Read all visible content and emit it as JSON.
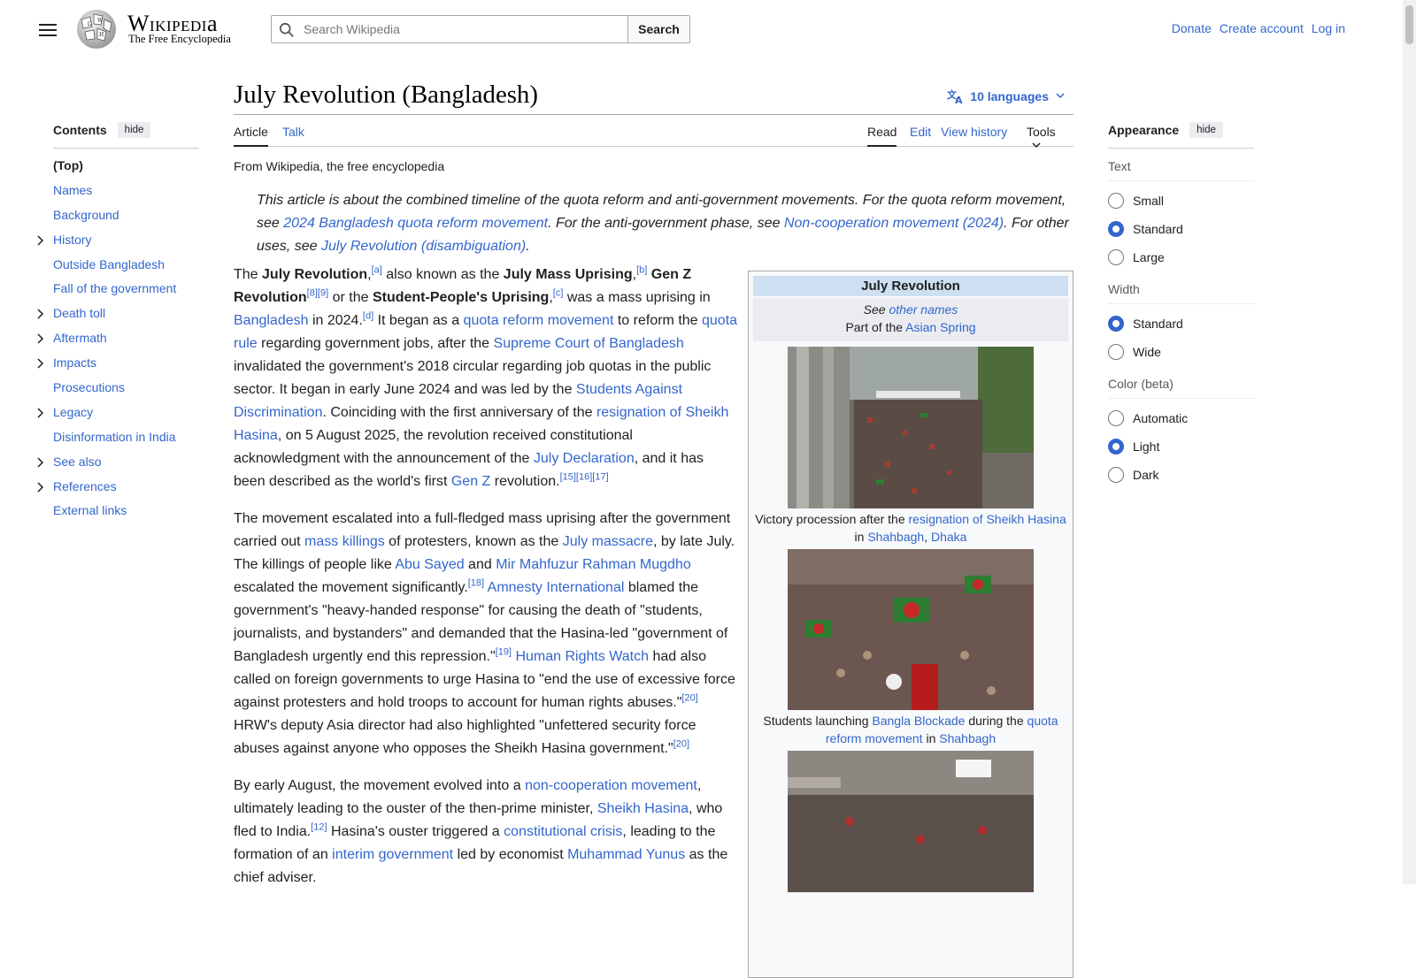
{
  "header": {
    "wordmark": "Wikipedia",
    "tagline": "The Free Encyclopedia",
    "search_placeholder": "Search Wikipedia",
    "search_button": "Search",
    "links": [
      "Donate",
      "Create account",
      "Log in"
    ]
  },
  "toc": {
    "title": "Contents",
    "hide_label": "hide",
    "items": [
      {
        "label": "(Top)",
        "expandable": false
      },
      {
        "label": "Names",
        "expandable": false
      },
      {
        "label": "Background",
        "expandable": false
      },
      {
        "label": "History",
        "expandable": true
      },
      {
        "label": "Outside Bangladesh",
        "expandable": false
      },
      {
        "label": "Fall of the government",
        "expandable": false
      },
      {
        "label": "Death toll",
        "expandable": true
      },
      {
        "label": "Aftermath",
        "expandable": true
      },
      {
        "label": "Impacts",
        "expandable": true
      },
      {
        "label": "Prosecutions",
        "expandable": false
      },
      {
        "label": "Legacy",
        "expandable": true
      },
      {
        "label": "Disinformation in India",
        "expandable": false
      },
      {
        "label": "See also",
        "expandable": true
      },
      {
        "label": "References",
        "expandable": true
      },
      {
        "label": "External links",
        "expandable": false
      }
    ]
  },
  "article": {
    "title": "July Revolution (Bangladesh)",
    "languages": "10 languages",
    "tabs": {
      "article": "Article",
      "talk": "Talk",
      "read": "Read",
      "edit": "Edit",
      "history": "View history",
      "tools": "Tools"
    },
    "from": "From Wikipedia, the free encyclopedia",
    "hatnote": [
      {
        "t": "This article is about the combined timeline of the quota reform and anti-government movements. For the quota reform movement, see "
      },
      {
        "t": "2024 Bangladesh quota reform movement",
        "link": true
      },
      {
        "t": ". For the anti-government phase, see "
      },
      {
        "t": "Non-cooperation movement (2024)",
        "link": true
      },
      {
        "t": ". For other uses, see "
      },
      {
        "t": "July Revolution (disambiguation)",
        "link": true
      },
      {
        "t": "."
      }
    ],
    "paragraphs": [
      [
        {
          "t": "The "
        },
        {
          "t": "July Revolution",
          "b": true
        },
        {
          "t": ",",
          "b": false
        },
        {
          "t": "[a]",
          "sup": true
        },
        {
          "t": " also known as the "
        },
        {
          "t": "July Mass Uprising",
          "b": true
        },
        {
          "t": ","
        },
        {
          "t": "[b]",
          "sup": true
        },
        {
          "t": " "
        },
        {
          "t": "Gen Z Revolution",
          "b": true
        },
        {
          "t": "[8][9]",
          "sup": true
        },
        {
          "t": " or the "
        },
        {
          "t": "Student-People's Uprising",
          "b": true
        },
        {
          "t": ","
        },
        {
          "t": "[c]",
          "sup": true
        },
        {
          "t": " was a mass uprising in "
        },
        {
          "t": "Bangladesh",
          "link": true
        },
        {
          "t": " in 2024."
        },
        {
          "t": "[d]",
          "sup": true
        },
        {
          "t": " It began as a "
        },
        {
          "t": "quota reform movement",
          "link": true
        },
        {
          "t": " to reform the "
        },
        {
          "t": "quota rule",
          "link": true
        },
        {
          "t": " regarding government jobs, after the "
        },
        {
          "t": "Supreme Court of Bangladesh",
          "link": true
        },
        {
          "t": " invalidated the government's 2018 circular regarding job quotas in the public sector. It began in early June 2024 and was led by the "
        },
        {
          "t": "Students Against Discrimination",
          "link": true
        },
        {
          "t": ". Coinciding with the first anniversary of the "
        },
        {
          "t": "resignation of Sheikh Hasina",
          "link": true
        },
        {
          "t": ", on 5 August 2025, the revolution received constitutional acknowledgment with the announcement of the "
        },
        {
          "t": "July Declaration",
          "link": true
        },
        {
          "t": ", and it has been described as the world's first "
        },
        {
          "t": "Gen Z",
          "link": true
        },
        {
          "t": " revolution."
        },
        {
          "t": "[15][16][17]",
          "sup": true
        }
      ],
      [
        {
          "t": "The movement escalated into a full-fledged mass uprising after the government carried out "
        },
        {
          "t": "mass killings",
          "link": true
        },
        {
          "t": " of protesters, known as the "
        },
        {
          "t": "July massacre",
          "link": true
        },
        {
          "t": ", by late July. The killings of people like "
        },
        {
          "t": "Abu Sayed",
          "link": true
        },
        {
          "t": " and "
        },
        {
          "t": "Mir Mahfuzur Rahman Mugdho",
          "link": true
        },
        {
          "t": " escalated the movement significantly."
        },
        {
          "t": "[18]",
          "sup": true
        },
        {
          "t": " "
        },
        {
          "t": "Amnesty International",
          "link": true
        },
        {
          "t": " blamed the government's \"heavy-handed response\" for causing the death of \"students, journalists, and bystanders\" and demanded that the Hasina-led \"government of Bangladesh urgently end this repression.\""
        },
        {
          "t": "[19]",
          "sup": true
        },
        {
          "t": " "
        },
        {
          "t": "Human Rights Watch",
          "link": true
        },
        {
          "t": " had also called on foreign governments to urge Hasina to \"end the use of excessive force against protesters and hold troops to account for human rights abuses.\""
        },
        {
          "t": "[20]",
          "sup": true
        },
        {
          "t": " HRW's deputy Asia director had also highlighted \"unfettered security force abuses against anyone who opposes the Sheikh Hasina government.\""
        },
        {
          "t": "[20]",
          "sup": true
        }
      ],
      [
        {
          "t": "By early August, the movement evolved into a "
        },
        {
          "t": "non-cooperation movement",
          "link": true
        },
        {
          "t": ", ultimately leading to the ouster of the then-prime minister, "
        },
        {
          "t": "Sheikh Hasina",
          "link": true
        },
        {
          "t": ", who fled to India."
        },
        {
          "t": "[12]",
          "sup": true
        },
        {
          "t": " Hasina's ouster triggered a "
        },
        {
          "t": "constitutional crisis",
          "link": true
        },
        {
          "t": ", leading to the formation of an "
        },
        {
          "t": "interim government",
          "link": true
        },
        {
          "t": " led by economist "
        },
        {
          "t": "Muhammad Yunus",
          "link": true
        },
        {
          "t": " as the chief adviser."
        }
      ]
    ]
  },
  "infobox": {
    "title": "July Revolution",
    "see_prefix": "See ",
    "see_link": "other names",
    "part_prefix": "Part of the ",
    "part_link": "Asian Spring",
    "captions": [
      [
        {
          "t": "Victory procession after the "
        },
        {
          "t": "resignation of Sheikh Hasina",
          "link": true
        },
        {
          "t": " in "
        },
        {
          "t": "Shahbagh",
          "link": true
        },
        {
          "t": ", "
        },
        {
          "t": "Dhaka",
          "link": true
        }
      ],
      [
        {
          "t": "Students launching "
        },
        {
          "t": "Bangla Blockade",
          "link": true
        },
        {
          "t": " during the "
        },
        {
          "t": "quota reform movement",
          "link": true
        },
        {
          "t": " in "
        },
        {
          "t": "Shahbagh",
          "link": true
        }
      ]
    ]
  },
  "appearance": {
    "title": "Appearance",
    "hide_label": "hide",
    "groups": [
      {
        "label": "Text",
        "options": [
          {
            "label": "Small",
            "on": false
          },
          {
            "label": "Standard",
            "on": true
          },
          {
            "label": "Large",
            "on": false
          }
        ]
      },
      {
        "label": "Width",
        "options": [
          {
            "label": "Standard",
            "on": true
          },
          {
            "label": "Wide",
            "on": false
          }
        ]
      },
      {
        "label": "Color (beta)",
        "options": [
          {
            "label": "Automatic",
            "on": false
          },
          {
            "label": "Light",
            "on": true
          },
          {
            "label": "Dark",
            "on": false
          }
        ]
      }
    ]
  },
  "colors": {
    "link": "#3366cc",
    "text": "#202122",
    "infobox_title_bg": "#cedff2"
  }
}
